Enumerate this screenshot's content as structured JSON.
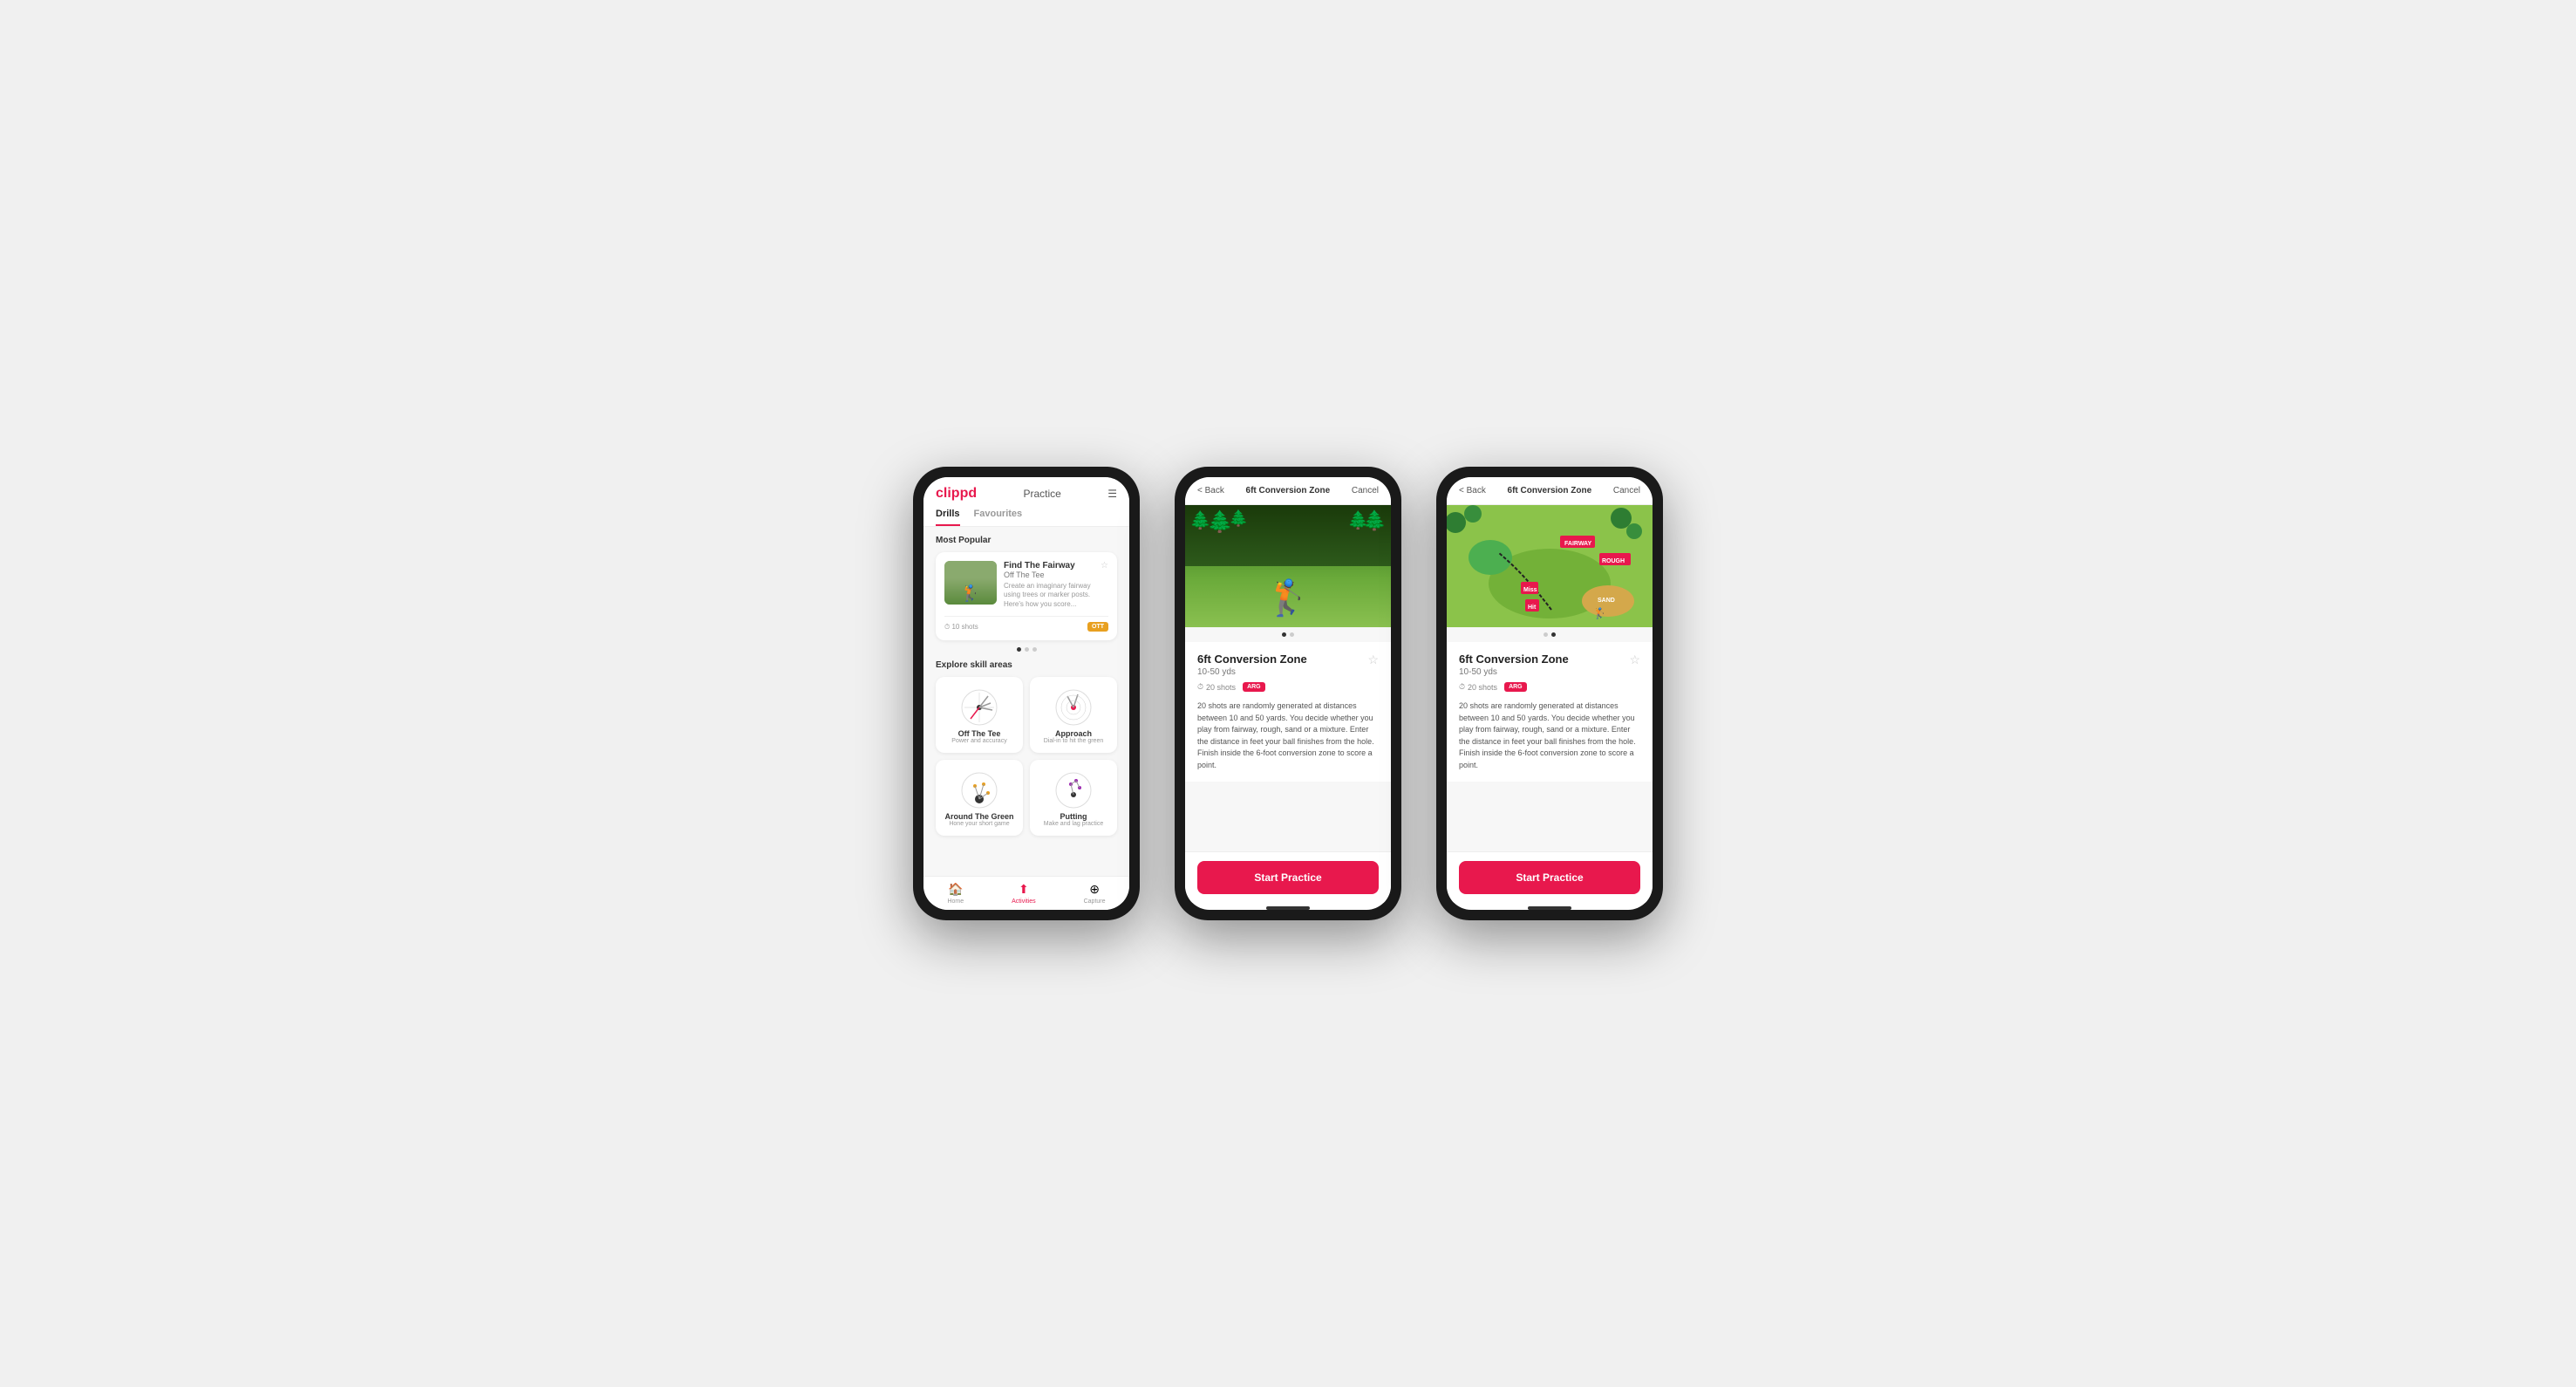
{
  "phones": {
    "phone1": {
      "header": {
        "logo": "clippd",
        "title": "Practice",
        "menu_icon": "☰"
      },
      "tabs": [
        {
          "label": "Drills",
          "active": true
        },
        {
          "label": "Favourites",
          "active": false
        }
      ],
      "most_popular_label": "Most Popular",
      "featured_drill": {
        "title": "Find The Fairway",
        "subtitle": "Off The Tee",
        "description": "Create an imaginary fairway using trees or marker posts. Here's how you score...",
        "shots": "10 shots",
        "badge": "OTT"
      },
      "explore_label": "Explore skill areas",
      "skill_areas": [
        {
          "name": "Off The Tee",
          "desc": "Power and accuracy"
        },
        {
          "name": "Approach",
          "desc": "Dial-in to hit the green"
        },
        {
          "name": "Around The Green",
          "desc": "Hone your short game"
        },
        {
          "name": "Putting",
          "desc": "Make and lag practice"
        }
      ],
      "bottom_nav": [
        {
          "label": "Home",
          "icon": "🏠",
          "active": false
        },
        {
          "label": "Activities",
          "icon": "⬆",
          "active": true
        },
        {
          "label": "Capture",
          "icon": "⊕",
          "active": false
        }
      ]
    },
    "phone2": {
      "header": {
        "back_label": "< Back",
        "title": "6ft Conversion Zone",
        "cancel_label": "Cancel"
      },
      "drill": {
        "title": "6ft Conversion Zone",
        "range": "10-50 yds",
        "shots": "20 shots",
        "badge": "ARG",
        "description": "20 shots are randomly generated at distances between 10 and 50 yards. You decide whether you play from fairway, rough, sand or a mixture. Enter the distance in feet your ball finishes from the hole. Finish inside the 6-foot conversion zone to score a point.",
        "start_label": "Start Practice"
      }
    },
    "phone3": {
      "header": {
        "back_label": "< Back",
        "title": "6ft Conversion Zone",
        "cancel_label": "Cancel"
      },
      "drill": {
        "title": "6ft Conversion Zone",
        "range": "10-50 yds",
        "shots": "20 shots",
        "badge": "ARG",
        "description": "20 shots are randomly generated at distances between 10 and 50 yards. You decide whether you play from fairway, rough, sand or a mixture. Enter the distance in feet your ball finishes from the hole. Finish inside the 6-foot conversion zone to score a point.",
        "start_label": "Start Practice"
      }
    }
  }
}
